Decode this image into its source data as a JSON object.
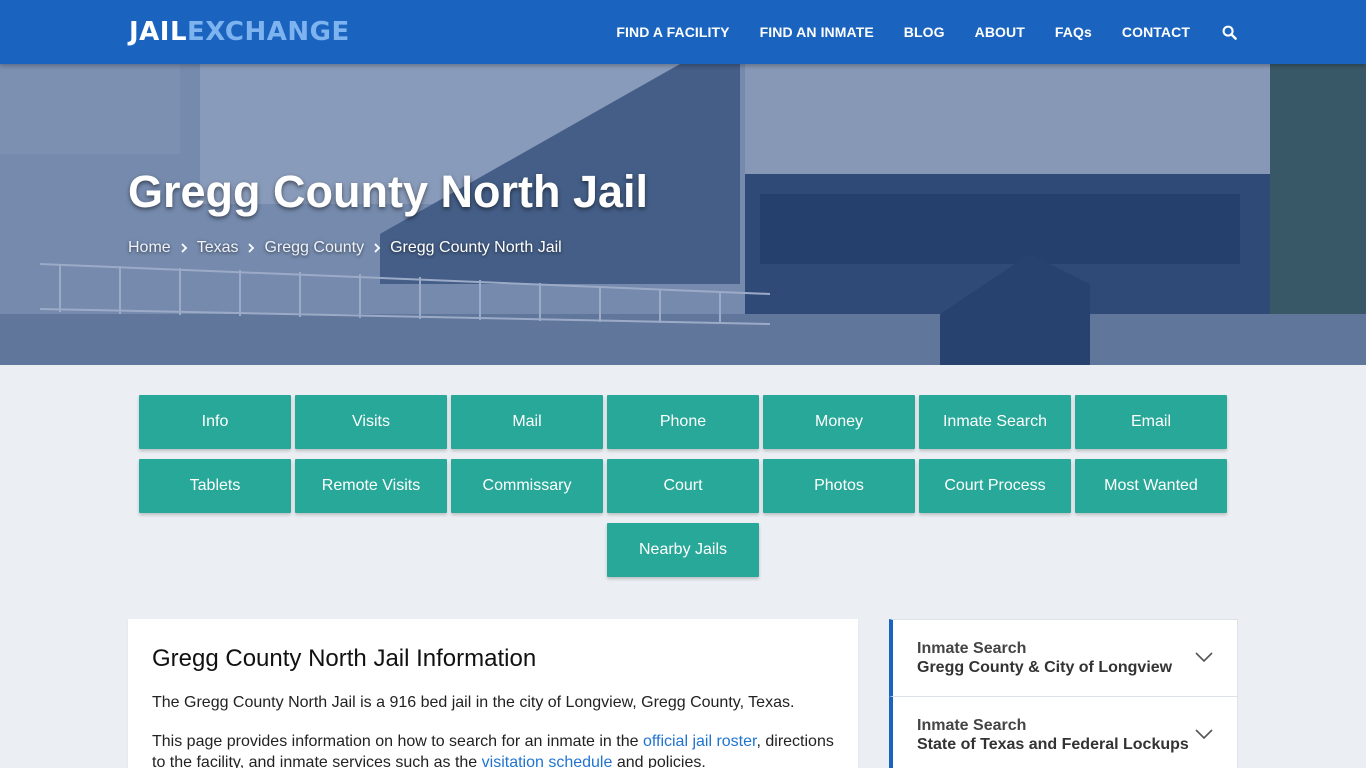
{
  "header": {
    "logo_part1": "JAIL",
    "logo_part2": "EXCHANGE",
    "nav": [
      "FIND A FACILITY",
      "FIND AN INMATE",
      "BLOG",
      "ABOUT",
      "FAQs",
      "CONTACT"
    ],
    "search_icon": "search-icon"
  },
  "hero": {
    "title": "Gregg County North Jail",
    "breadcrumb": [
      "Home",
      "Texas",
      "Gregg County",
      "Gregg County North Jail"
    ]
  },
  "tiles": [
    "Info",
    "Visits",
    "Mail",
    "Phone",
    "Money",
    "Inmate Search",
    "Email",
    "Tablets",
    "Remote Visits",
    "Commissary",
    "Court",
    "Photos",
    "Court Process",
    "Most Wanted",
    "Nearby Jails"
  ],
  "content": {
    "heading": "Gregg County North Jail Information",
    "p1": "The Gregg County North Jail is a 916 bed jail in the city of Longview, Gregg County, Texas.",
    "p2_a": "This page provides information on how to search for an inmate in the ",
    "p2_link1": "official jail roster",
    "p2_b": ", directions to the facility, and inmate services such as the ",
    "p2_link2": "visitation schedule",
    "p2_c": " and policies."
  },
  "sidebar": [
    {
      "line1": "Inmate Search",
      "line2": "Gregg County & City of Longview"
    },
    {
      "line1": "Inmate Search",
      "line2": "State of Texas and Federal Lockups"
    }
  ],
  "colors": {
    "header_blue": "#1a64c0",
    "logo_accent": "#7db3ee",
    "tile_teal": "#27a898",
    "link_blue": "#1f74d0",
    "page_bg": "#ebeef2"
  }
}
